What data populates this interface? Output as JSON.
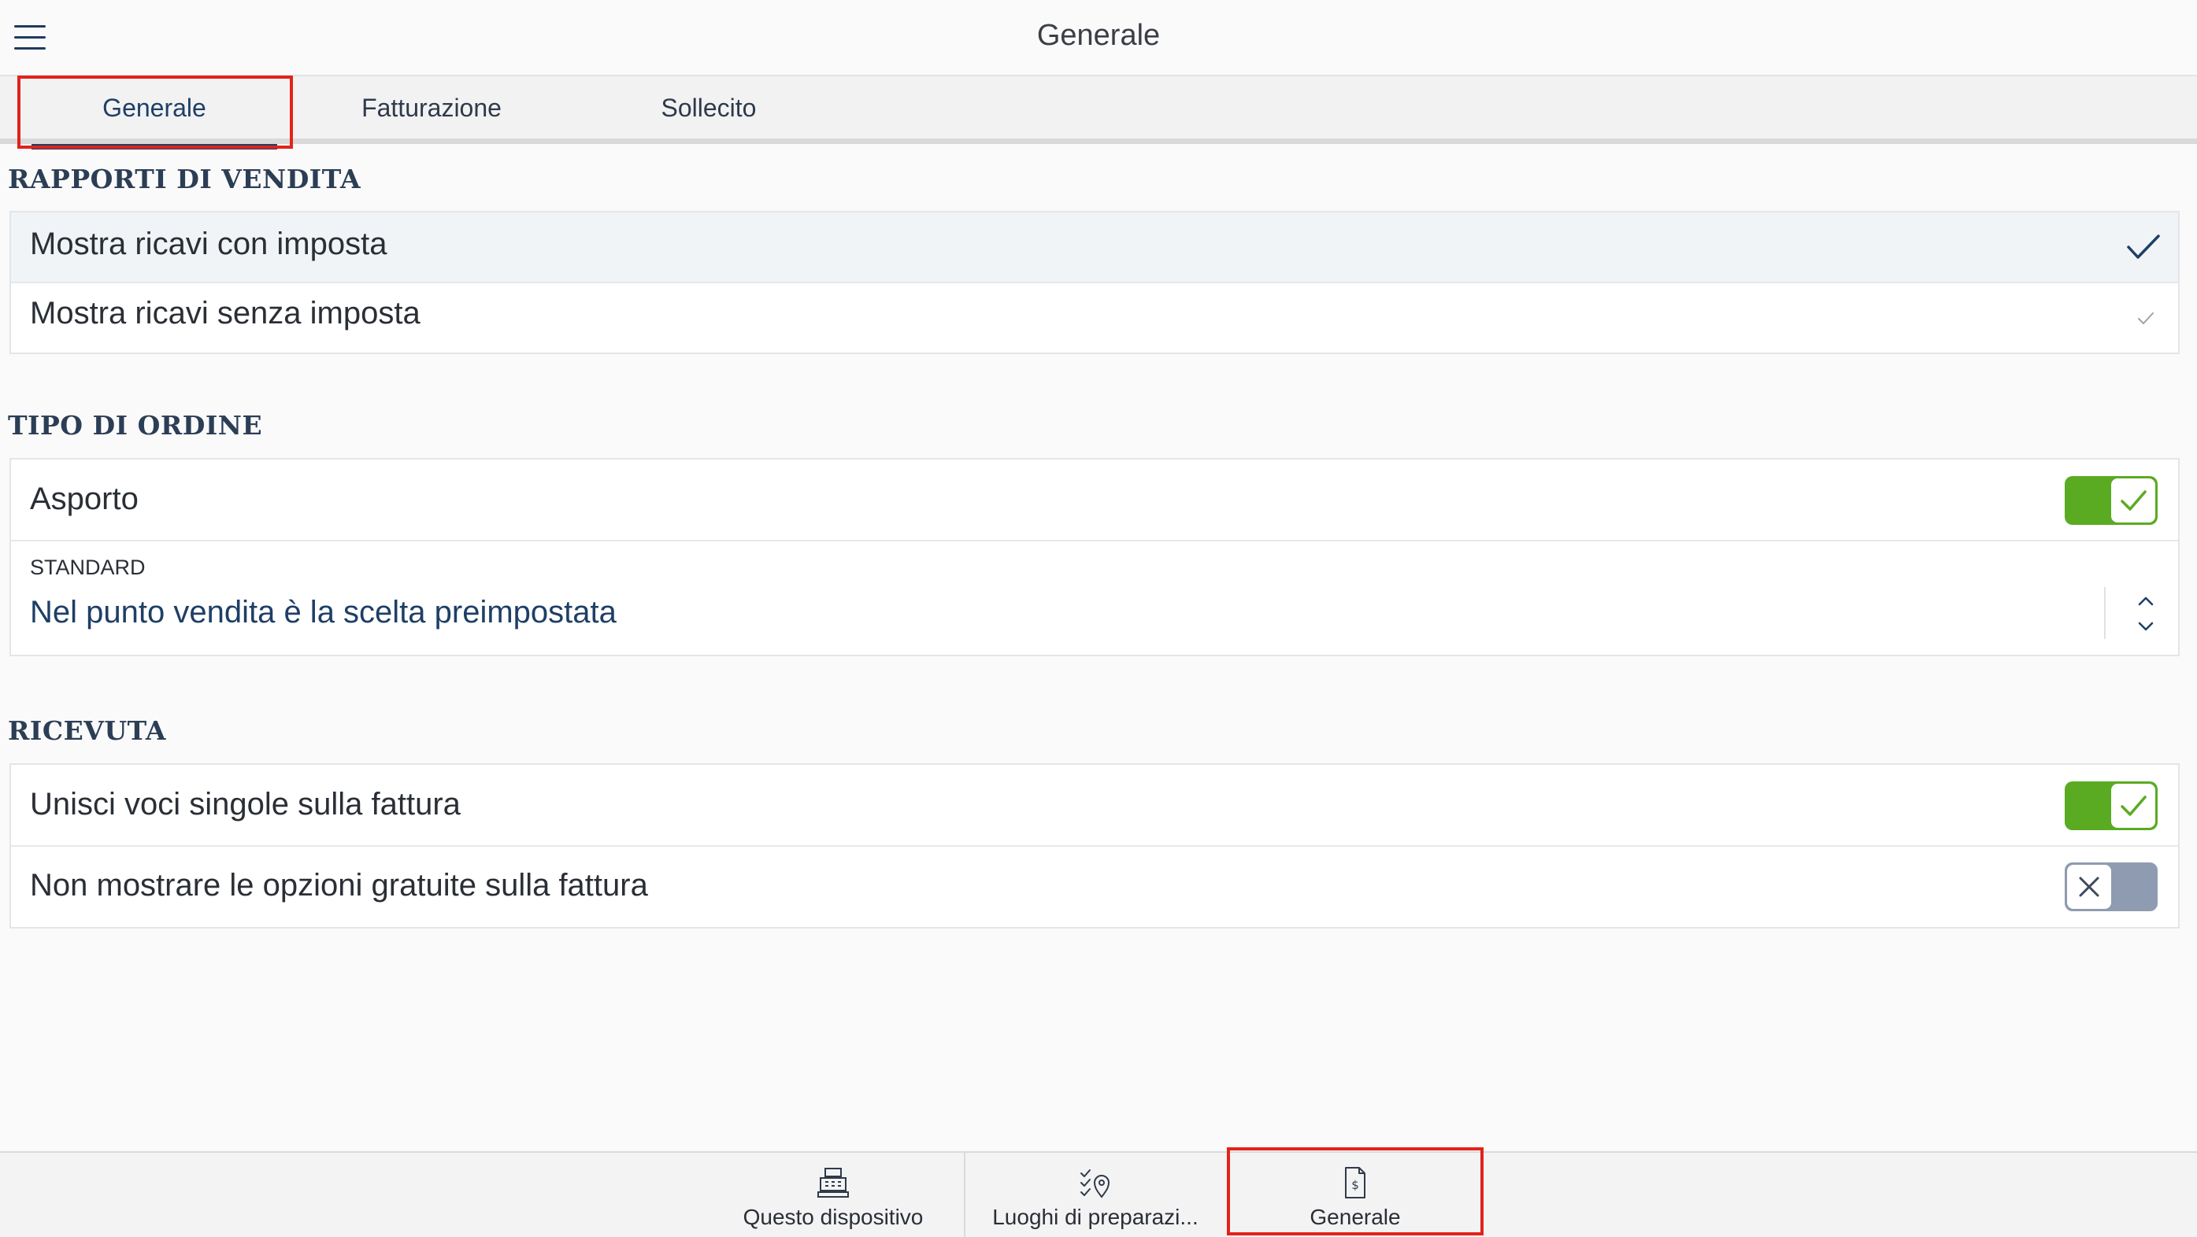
{
  "header": {
    "title": "Generale",
    "menu_icon": "hamburger-menu-icon"
  },
  "tabs": [
    {
      "label": "Generale",
      "active": true
    },
    {
      "label": "Fatturazione",
      "active": false
    },
    {
      "label": "Sollecito",
      "active": false
    }
  ],
  "sales_reports": {
    "title": "RAPPORTI DI VENDITA",
    "options": [
      {
        "label": "Mostra ricavi con imposta",
        "selected": true
      },
      {
        "label": "Mostra ricavi senza imposta",
        "selected": false
      }
    ]
  },
  "order_type": {
    "title": "TIPO DI ORDINE",
    "takeaway": {
      "label": "Asporto",
      "enabled": true
    },
    "default": {
      "caption": "STANDARD",
      "value": "Nel punto vendita è la scelta preimpostata"
    }
  },
  "receipt": {
    "title": "RICEVUTA",
    "merge_items": {
      "label": "Unisci voci singole sulla fattura",
      "enabled": true
    },
    "hide_free_options": {
      "label": "Non mostrare le opzioni gratuite sulla fattura",
      "enabled": false
    }
  },
  "bottom_nav": {
    "items": [
      {
        "label": "Questo dispositivo",
        "icon": "cash-register-icon",
        "active": false
      },
      {
        "label": "Luoghi di preparazi...",
        "icon": "checklist-location-icon",
        "active": false
      },
      {
        "label": "Generale",
        "icon": "invoice-dollar-icon",
        "active": true
      }
    ]
  },
  "colors": {
    "accent": "#1e3f66",
    "toggle_on": "#5aab22",
    "toggle_off": "#8f9bb0",
    "highlight": "#e2231a"
  }
}
